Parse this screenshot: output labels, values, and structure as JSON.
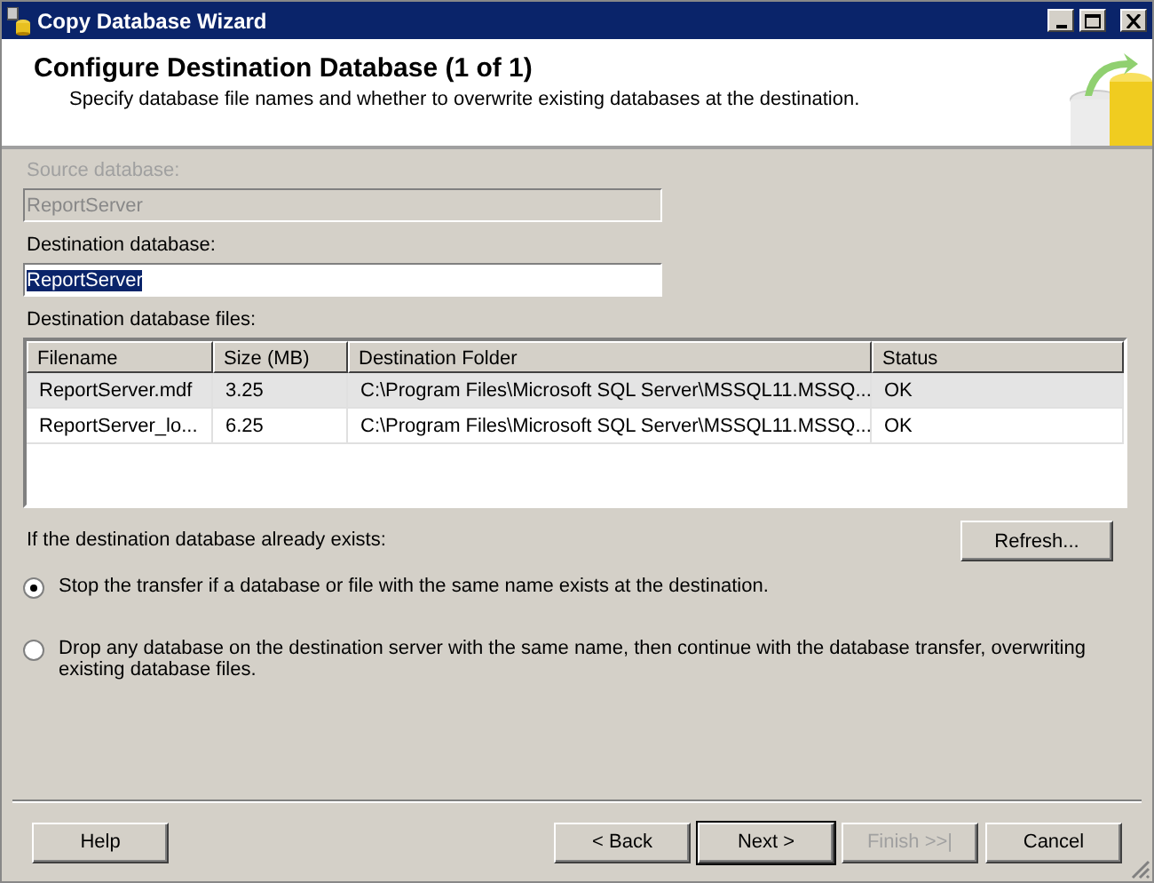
{
  "window": {
    "title": "Copy Database Wizard"
  },
  "header": {
    "title": "Configure Destination Database (1 of 1)",
    "subtitle": "Specify database file names and whether to overwrite existing databases at the destination."
  },
  "source_database": {
    "label": "Source database:",
    "value": "ReportServer",
    "disabled": true
  },
  "destination_database": {
    "label": "Destination database:",
    "value": "ReportServer",
    "disabled": false,
    "selected": true
  },
  "files": {
    "label": "Destination database files:",
    "columns": [
      "Filename",
      "Size (MB)",
      "Destination Folder",
      "Status"
    ],
    "rows": [
      {
        "cells": [
          "ReportServer.mdf",
          "3.25",
          "C:\\Program Files\\Microsoft SQL Server\\MSSQL11.MSSQ...",
          "OK"
        ],
        "selected": true
      },
      {
        "cells": [
          "ReportServer_lo...",
          "6.25",
          "C:\\Program Files\\Microsoft SQL Server\\MSSQL11.MSSQ...",
          "OK"
        ],
        "selected": false
      }
    ]
  },
  "exists_label": "If the destination database already exists:",
  "refresh_button": "Refresh...",
  "options": [
    {
      "label": "Stop the transfer if a database or file with the same name exists at the destination.",
      "selected": true
    },
    {
      "label": "Drop any database on the destination server with the same name, then continue with the database transfer, overwriting existing database files.",
      "selected": false
    }
  ],
  "help_button": {
    "label": "Help",
    "disabled": false,
    "default": false
  },
  "nav_buttons": [
    {
      "label": "< Back",
      "disabled": false,
      "default": false
    },
    {
      "label": "Next >",
      "disabled": false,
      "default": true
    },
    {
      "label": "Finish >>|",
      "disabled": true,
      "default": false
    },
    {
      "label": "Cancel",
      "disabled": false,
      "default": false
    }
  ]
}
